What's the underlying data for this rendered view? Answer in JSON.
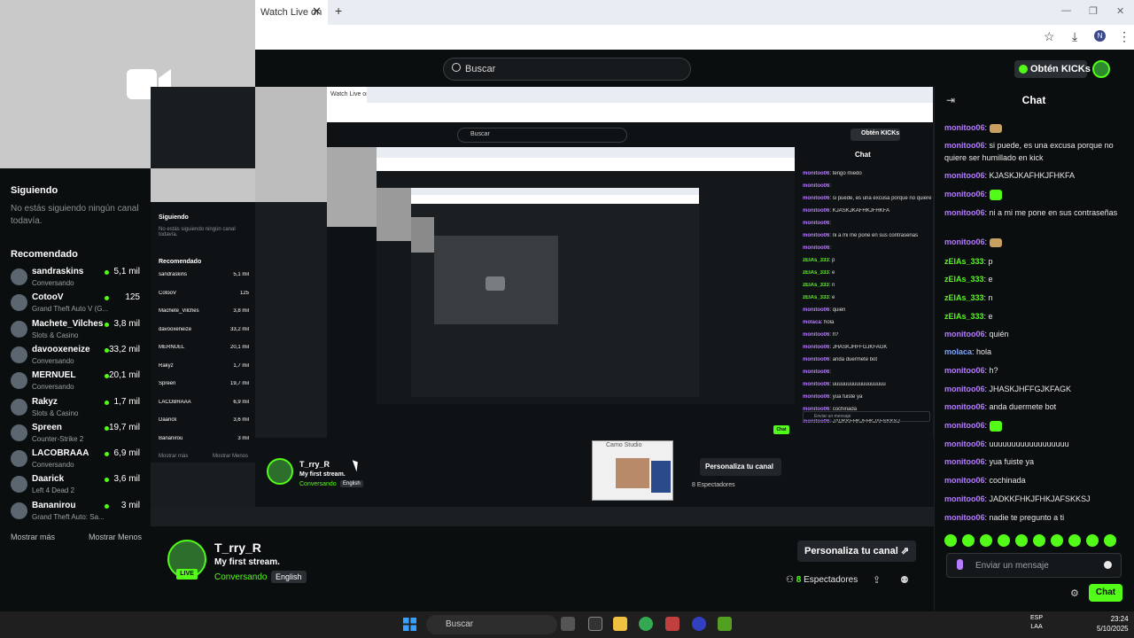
{
  "browser": {
    "tab_title": "Watch Live on",
    "tab_close": "✕",
    "tab_new": "+",
    "controls": [
      "—",
      "❐",
      "✕"
    ],
    "toolbar_icons": [
      "☆",
      "⤓",
      "N",
      "⋮"
    ]
  },
  "header": {
    "search_placeholder": "Buscar",
    "obten_label": "Obtén KICKs"
  },
  "sidebar": {
    "following_title": "Siguiendo",
    "following_empty": "No estás siguiendo ningún canal todavía.",
    "recommended_title": "Recomendado",
    "items": [
      {
        "name": "sandraskins",
        "sub": "Conversando",
        "count": "5,1 mil"
      },
      {
        "name": "CotooV",
        "sub": "Grand Theft Auto V (G...",
        "count": "125"
      },
      {
        "name": "Machete_Vilches",
        "sub": "Slots & Casino",
        "count": "3,8 mil"
      },
      {
        "name": "davooxeneize",
        "sub": "Conversando",
        "count": "33,2 mil"
      },
      {
        "name": "MERNUEL",
        "sub": "Conversando",
        "count": "20,1 mil"
      },
      {
        "name": "Rakyz",
        "sub": "Slots & Casino",
        "count": "1,7 mil"
      },
      {
        "name": "Spreen",
        "sub": "Counter-Strike 2",
        "count": "19,7 mil"
      },
      {
        "name": "LACOBRAAA",
        "sub": "Conversando",
        "count": "6,9 mil"
      },
      {
        "name": "Daarick",
        "sub": "Left 4 Dead 2",
        "count": "3,6 mil"
      },
      {
        "name": "Bananirou",
        "sub": "Grand Theft Auto: Sa...",
        "count": "3 mil"
      }
    ],
    "show_more": "Mostrar más",
    "show_less": "Mostrar Menos"
  },
  "nested": {
    "tab_title": "Watch Live on",
    "search_placeholder": "Buscar",
    "obten_label": "Obtén KICKs",
    "following_title": "Siguiendo",
    "following_empty": "No estás siguiendo ningún canal todavía.",
    "recommended_title": "Recomendado",
    "items": [
      "sandraskins",
      "CotooV",
      "Machete_Vilches",
      "davooxeneize",
      "MERNUEL",
      "Rakyz",
      "Spreen",
      "LACOBRAAA",
      "Daarick",
      "Bananirou"
    ],
    "counts": [
      "5,1 mil",
      "125",
      "3,8 mil",
      "33,2 mil",
      "20,1 mil",
      "1,7 mil",
      "19,7 mil",
      "6,9 mil",
      "3,6 mil",
      "3 mil"
    ],
    "show_more": "Mostrar más",
    "show_less": "Mostrar Menos",
    "chat_title": "Chat",
    "streamer": "T_rry_R",
    "stream_title": "My first stream.",
    "category": "Conversando",
    "lang": "English",
    "personaliza": "Personaliza tu canal",
    "spectators": "8 Espectadores",
    "cam_title": "Camo Studio",
    "chat_lines": [
      {
        "user": "monitoo06",
        "text": "tengo miedo"
      },
      {
        "user": "monitoo06",
        "text": ""
      },
      {
        "user": "monitoo06",
        "text": "si puede, es una excusa porque no quiere ser humillado en kick"
      },
      {
        "user": "monitoo06",
        "text": "KJASKJKAFHKJFHKFA"
      },
      {
        "user": "monitoo06",
        "text": ""
      },
      {
        "user": "monitoo06",
        "text": "ni a mi me pone en sus contraseñas"
      },
      {
        "user": "monitoo06",
        "text": ""
      },
      {
        "user": "zElAs_333",
        "text": "p"
      },
      {
        "user": "zElAs_333",
        "text": "e"
      },
      {
        "user": "zElAs_333",
        "text": "n"
      },
      {
        "user": "zElAs_333",
        "text": "e"
      },
      {
        "user": "monitoo06",
        "text": "quién"
      },
      {
        "user": "molaca",
        "text": "hola"
      },
      {
        "user": "monitoo06",
        "text": "h?"
      },
      {
        "user": "monitoo06",
        "text": "JHASKJHFFGJKFAGK"
      },
      {
        "user": "monitoo06",
        "text": "anda duermete bot"
      },
      {
        "user": "monitoo06",
        "text": ""
      },
      {
        "user": "monitoo06",
        "text": "uuuuuuuuuuuuuuuuuu"
      },
      {
        "user": "monitoo06",
        "text": "yua fuiste ya"
      },
      {
        "user": "monitoo06",
        "text": "cochinada"
      },
      {
        "user": "monitoo06",
        "text": "JADKKFHKJFHKJAFSKKSJ"
      }
    ],
    "chat_placeholder": "Enviar un mensaje",
    "chat_button": "Chat"
  },
  "chat": {
    "title": "Chat",
    "messages": [
      {
        "user": "monitoo06",
        "text": "",
        "emote": "red",
        "color": "purple"
      },
      {
        "user": "monitoo06",
        "text": "si puede, es una excusa porque no quiere ser humillado en kick",
        "emote": "",
        "color": "purple"
      },
      {
        "user": "monitoo06",
        "text": "KJASKJKAFHKJFHKFA",
        "emote": "",
        "color": "purple"
      },
      {
        "user": "monitoo06",
        "text": "",
        "emote": "green",
        "color": "purple"
      },
      {
        "user": "monitoo06",
        "text": "ni a mi me pone en sus contraseñas",
        "emote": "",
        "color": "purple"
      },
      {
        "user": "monitoo06",
        "text": "",
        "emote": "red",
        "color": "purple"
      },
      {
        "user": "zElAs_333",
        "text": "p",
        "emote": "",
        "color": "green"
      },
      {
        "user": "zElAs_333",
        "text": "e",
        "emote": "",
        "color": "green"
      },
      {
        "user": "zElAs_333",
        "text": "n",
        "emote": "",
        "color": "green"
      },
      {
        "user": "zElAs_333",
        "text": "e",
        "emote": "",
        "color": "green"
      },
      {
        "user": "monitoo06",
        "text": "quién",
        "emote": "",
        "color": "purple"
      },
      {
        "user": "molaca",
        "text": "hola",
        "emote": "",
        "color": "blue"
      },
      {
        "user": "monitoo06",
        "text": "h?",
        "emote": "",
        "color": "purple"
      },
      {
        "user": "monitoo06",
        "text": "JHASKJHFFGJKFAGK",
        "emote": "",
        "color": "purple"
      },
      {
        "user": "monitoo06",
        "text": "anda duermete bot",
        "emote": "",
        "color": "purple"
      },
      {
        "user": "monitoo06",
        "text": "",
        "emote": "green",
        "color": "purple"
      },
      {
        "user": "monitoo06",
        "text": "uuuuuuuuuuuuuuuuuu",
        "emote": "",
        "color": "purple"
      },
      {
        "user": "monitoo06",
        "text": "yua fuiste ya",
        "emote": "",
        "color": "purple"
      },
      {
        "user": "monitoo06",
        "text": "cochinada",
        "emote": "",
        "color": "purple"
      },
      {
        "user": "monitoo06",
        "text": "JADKKFHKJFHKJAFSKKSJ",
        "emote": "",
        "color": "purple"
      },
      {
        "user": "monitoo06",
        "text": "nadie te pregunto a ti",
        "emote": "",
        "color": "purple"
      }
    ],
    "input_placeholder": "Enviar un mensaje",
    "send_label": "Chat"
  },
  "stream": {
    "streamer": "T_rry_R",
    "title": "My first stream.",
    "category": "Conversando",
    "language": "English",
    "live_badge": "LIVE",
    "personaliza": "Personaliza tu canal",
    "spectators_count": "8",
    "spectators_label": "Espectadores"
  },
  "taskbar": {
    "search_placeholder": "Buscar",
    "lang_top": "ESP",
    "lang_bottom": "LAA",
    "time": "23:24",
    "date": "5/10/2025"
  },
  "colors": {
    "kick_green": "#53fc18",
    "background": "#0b0e0f",
    "username_purple": "#b57cff"
  }
}
